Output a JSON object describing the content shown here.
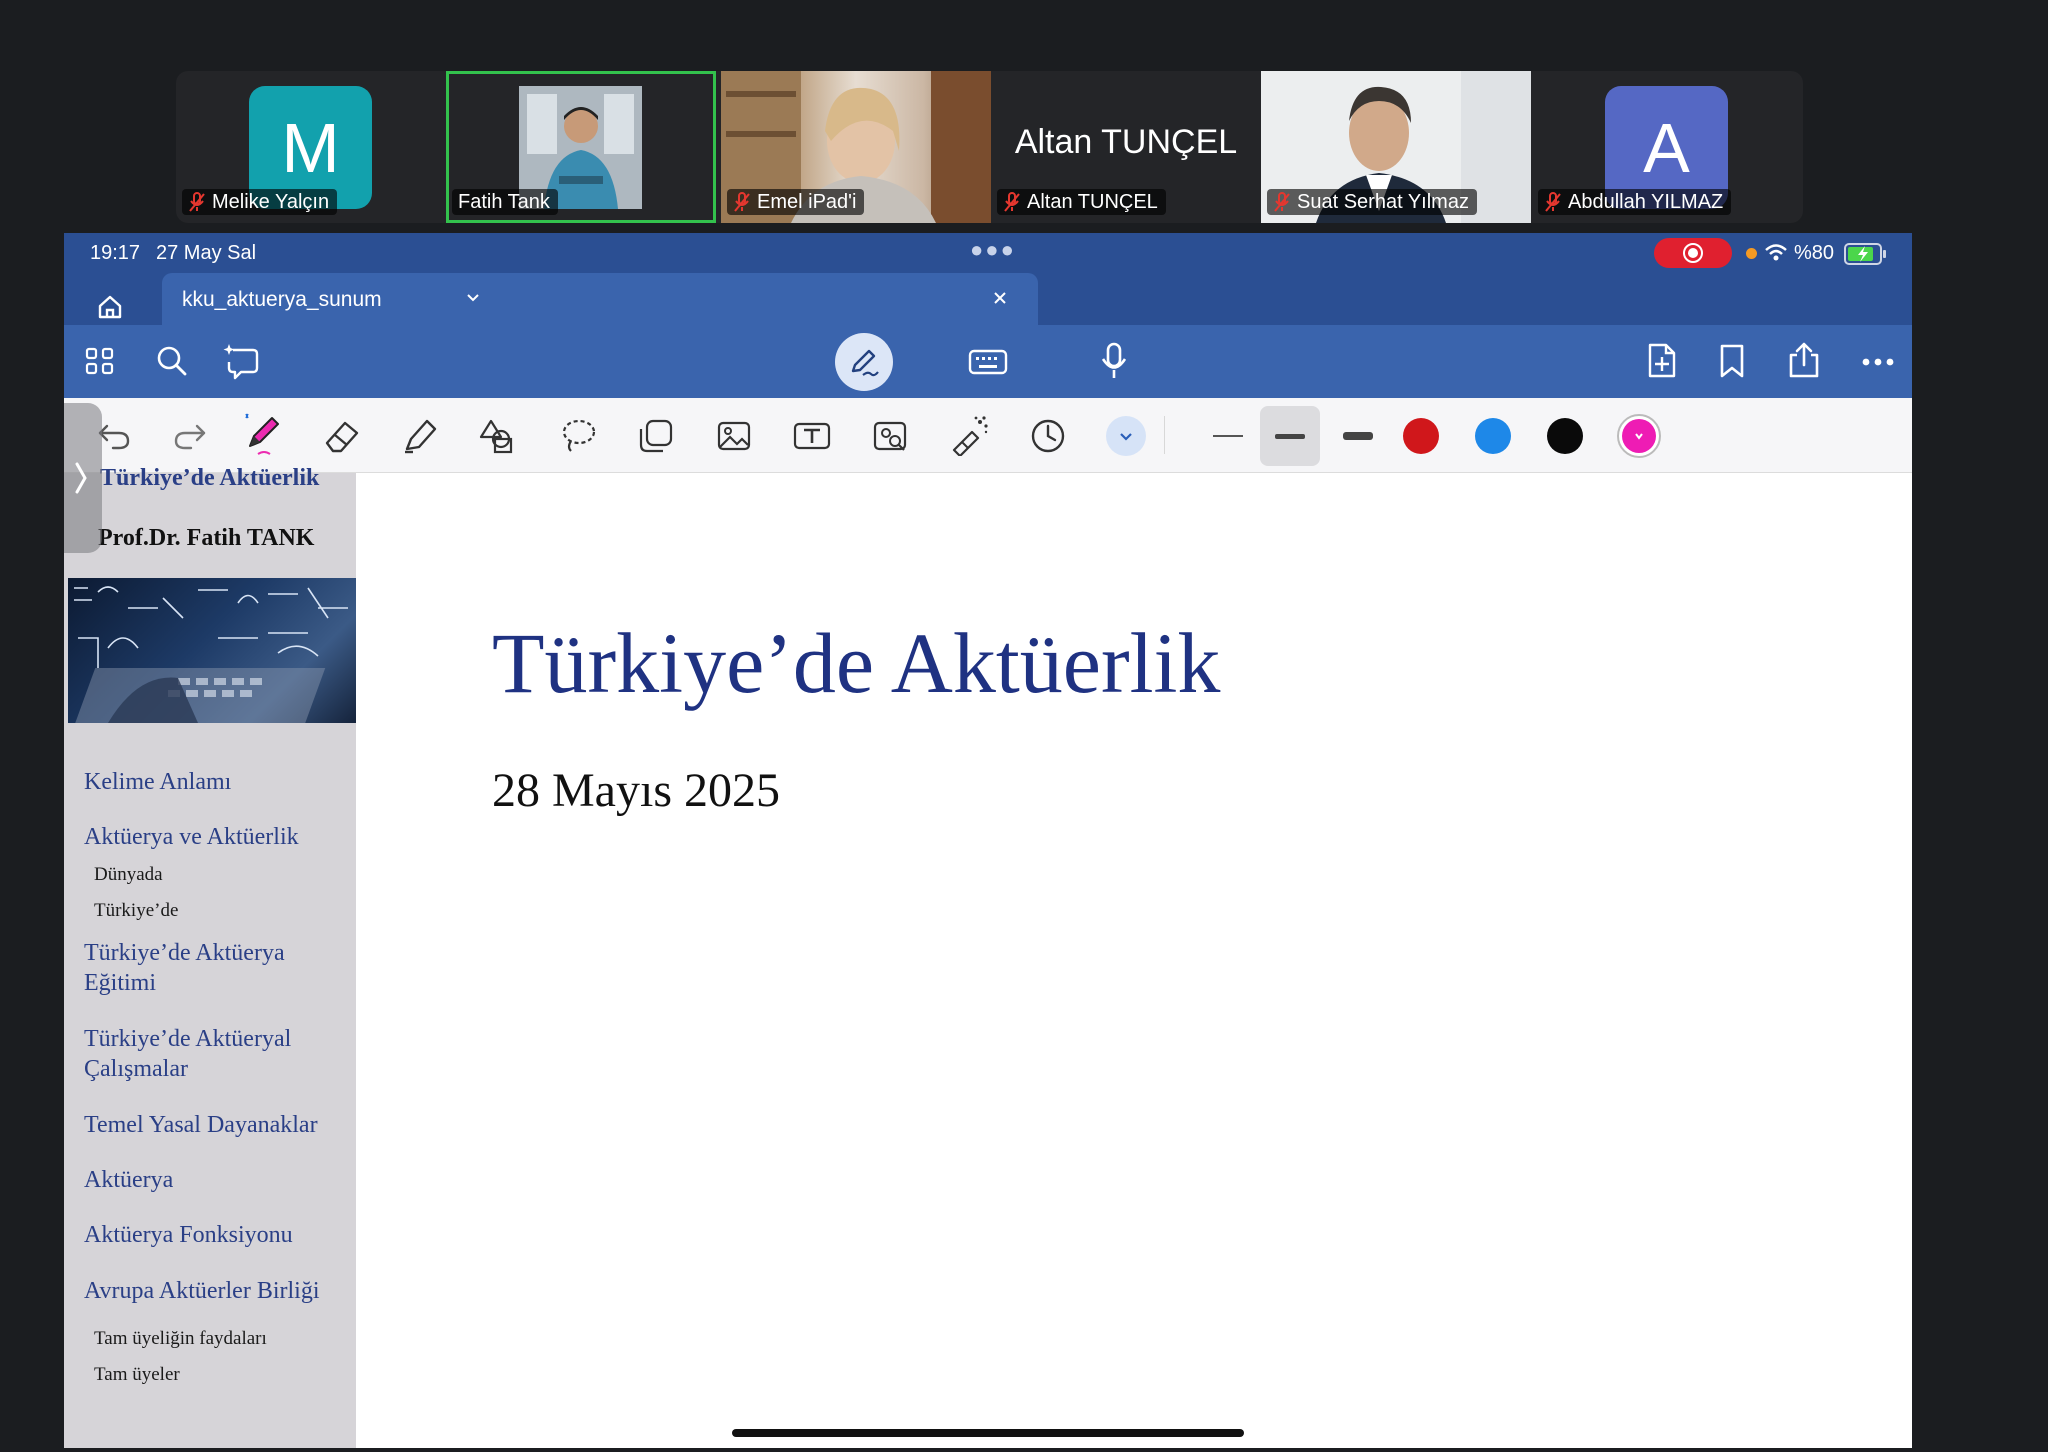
{
  "participants": [
    {
      "name": "Melike Yalçın",
      "avatar_letter": "M",
      "avatar_color": "#12a1ad",
      "muted": true
    },
    {
      "name": "Fatih Tank",
      "avatar_kind": "photo",
      "muted": false,
      "speaking": true
    },
    {
      "name": "Emel iPad'i",
      "avatar_kind": "video",
      "muted": true
    },
    {
      "name": "Altan TUNÇEL",
      "display_name": "Altan TUNÇEL",
      "muted": true
    },
    {
      "name": "Suat Serhat Yılmaz",
      "avatar_kind": "video",
      "muted": true
    },
    {
      "name": "Abdullah YILMAZ",
      "avatar_letter": "A",
      "avatar_color": "#5568c4",
      "muted": true
    }
  ],
  "status_bar": {
    "time": "19:17",
    "date": "27 May Sal",
    "battery": "%80",
    "recording_color": "#e0202f"
  },
  "document_tab": {
    "title": "kku_aktuerya_sunum"
  },
  "main_toolbar": {
    "left_icons": [
      "grid-icon",
      "search-icon",
      "ai-assistant-icon"
    ],
    "center_icons": [
      "pen-mode-icon",
      "keyboard-icon",
      "microphone-icon"
    ],
    "right_icons": [
      "add-page-icon",
      "bookmark-icon",
      "share-icon",
      "more-icon"
    ]
  },
  "draw_toolbar": {
    "tools": [
      "undo-icon",
      "redo-icon",
      "pen-icon",
      "eraser-icon",
      "highlighter-icon",
      "shapes-icon",
      "lasso-icon",
      "sticker-icon",
      "image-icon",
      "text-box-icon",
      "camera-icon",
      "laser-pointer-icon",
      "history-icon",
      "expand-icon"
    ],
    "stroke_sizes": [
      "thin",
      "medium",
      "thick"
    ],
    "colors": [
      "#d0171b",
      "#1e88e8",
      "#0a0a0a",
      "#ee1cb4"
    ]
  },
  "sidebar": {
    "header_title": "Türkiye’de Aktüerlik",
    "author": "Prof.Dr. Fatih TANK",
    "items": [
      {
        "label": "Kelime Anlamı",
        "level": 1
      },
      {
        "label": "Aktüerya ve Aktüerlik",
        "level": 1
      },
      {
        "label": "Dünyada",
        "level": 2
      },
      {
        "label": "Türkiye’de",
        "level": 2
      },
      {
        "label": "Türkiye’de Aktüerya Eğitimi",
        "level": 1
      },
      {
        "label": "Türkiye’de Aktüeryal Çalışmalar",
        "level": 1
      },
      {
        "label": "Temel Yasal Dayanaklar",
        "level": 1
      },
      {
        "label": "Aktüerya",
        "level": 1
      },
      {
        "label": "Aktüerya Fonksiyonu",
        "level": 1
      },
      {
        "label": "Avrupa Aktüerler Birliği",
        "level": 1
      },
      {
        "label": "Tam üyeliğin faydaları",
        "level": 2
      },
      {
        "label": "Tam üyeler",
        "level": 2
      }
    ]
  },
  "slide": {
    "title": "Türkiye’de Aktüerlik",
    "date": "28 Mayıs 2025"
  }
}
